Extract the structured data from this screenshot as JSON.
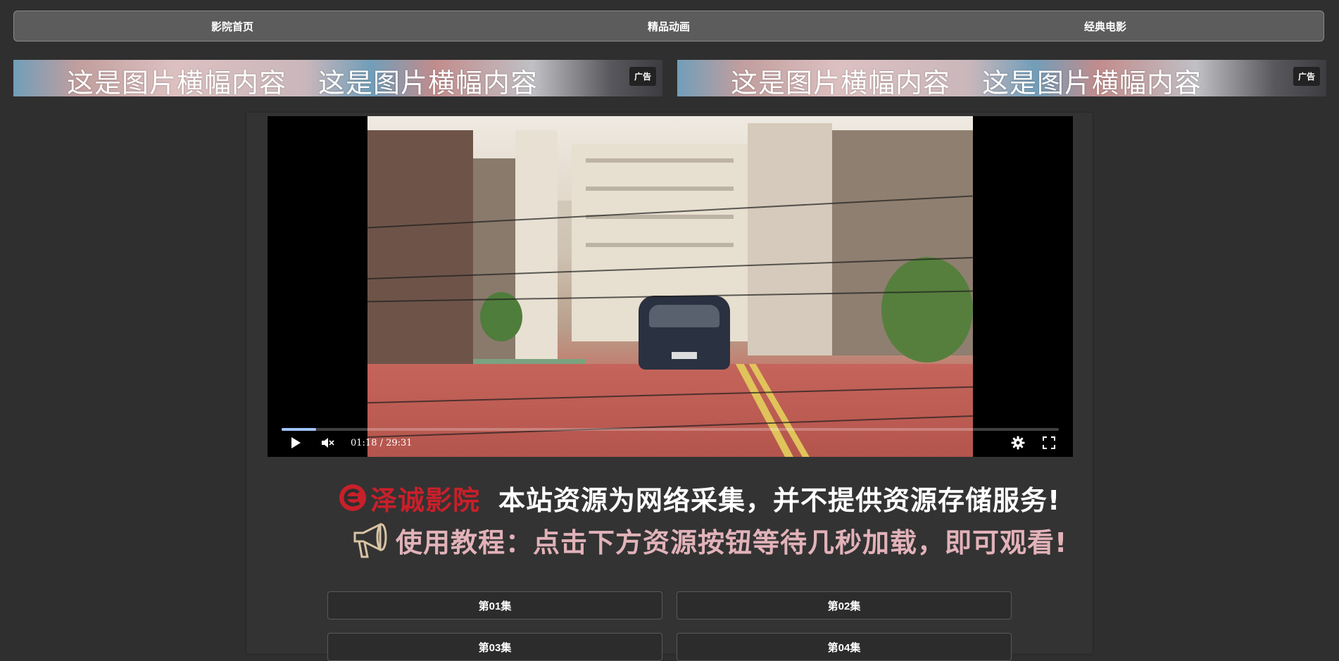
{
  "nav": {
    "items": [
      {
        "label": "影院首页"
      },
      {
        "label": "精品动画"
      },
      {
        "label": "经典电影"
      }
    ]
  },
  "banners": [
    {
      "text1": "这是图片横幅内容",
      "text2": "这是图片横幅内容",
      "badge": "广告"
    },
    {
      "text1": "这是图片横幅内容",
      "text2": "这是图片横幅内容",
      "badge": "广告"
    }
  ],
  "player": {
    "time_display": "01:18 / 29:31",
    "current_time": "01:18",
    "duration": "29:31",
    "progress_fraction": 0.044,
    "icons": {
      "play": "play-icon",
      "volume": "volume-icon",
      "settings": "gear-icon",
      "fullscreen": "fullscreen-icon"
    }
  },
  "notice": {
    "brand_name": "泽诚影院",
    "brand_color": "#c8202a",
    "statement": "本站资源为网络采集，并不提供资源存储服务!",
    "tutorial": "使用教程：点击下方资源按钮等待几秒加载，即可观看!",
    "tutorial_color": "#e2b2b9"
  },
  "episodes": [
    {
      "label": "第01集"
    },
    {
      "label": "第02集"
    },
    {
      "label": "第03集"
    },
    {
      "label": "第04集"
    }
  ]
}
